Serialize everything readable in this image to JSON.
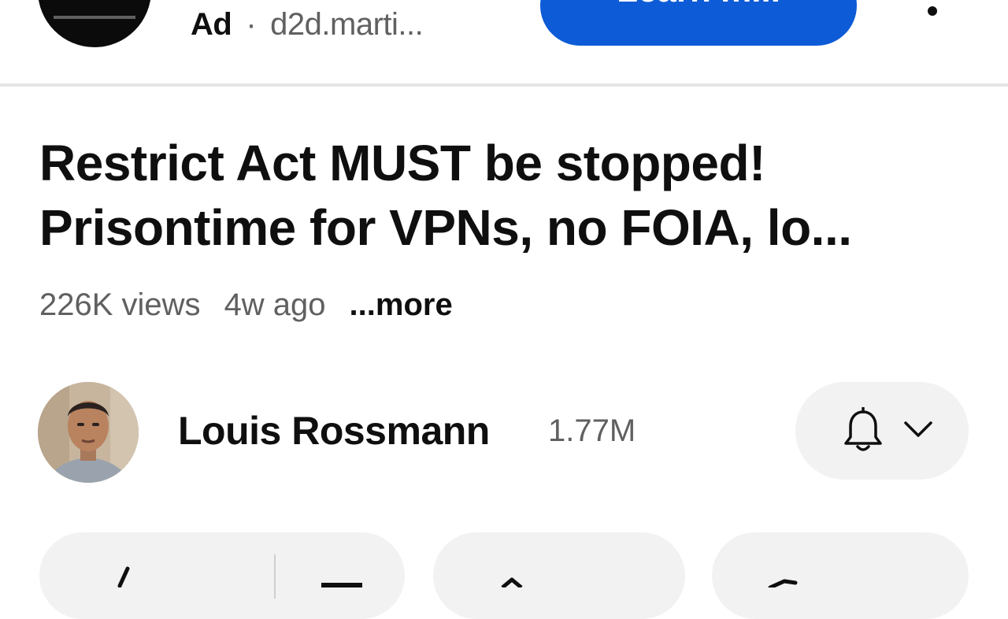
{
  "ad": {
    "label": "Ad",
    "separator": "·",
    "domain": "d2d.marti...",
    "cta_label": "Learn m..."
  },
  "video": {
    "title": "Restrict Act MUST be stopped! Prisontime for VPNs, no FOIA, lo...",
    "views": "226K views",
    "age": "4w ago",
    "more": "...more"
  },
  "channel": {
    "name": "Louis Rossmann",
    "subscribers": "1.77M"
  },
  "icons": {
    "ad_menu": "more-vert-icon",
    "subscribe": "bell-icon",
    "subscribe_menu": "chevron-down-icon",
    "like": "thumb-up-icon",
    "dislike": "thumb-down-icon",
    "share": "share-arrow-icon",
    "remix": "remix-icon"
  },
  "colors": {
    "cta": "#0d5bd6",
    "pill": "#f2f2f2",
    "secondary_text": "#606060"
  }
}
